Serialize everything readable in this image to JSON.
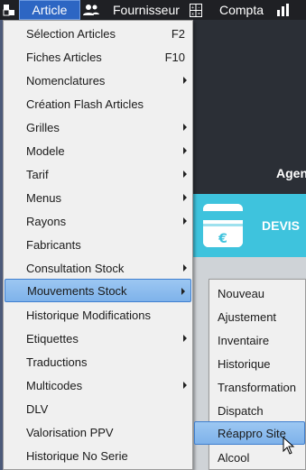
{
  "menubar": {
    "logo_icon": "app-logo-icon",
    "article_label": "Article",
    "users_icon": "users-icon",
    "fournisseur_label": "Fournisseur",
    "calculator_icon": "calculator-icon",
    "compta_label": "Compta",
    "chart_icon": "bar-chart-icon"
  },
  "background": {
    "agenda_fragment": "Agen",
    "devis_label": "DEVIS",
    "devis_icon": "euro-card-icon",
    "accent_color": "#3ec3dd"
  },
  "article_menu": {
    "items": [
      {
        "label": "Sélection Articles",
        "shortcut": "F2",
        "submenu": false
      },
      {
        "label": "Fiches Articles",
        "shortcut": "F10",
        "submenu": false
      },
      {
        "label": "Nomenclatures",
        "shortcut": "",
        "submenu": true
      },
      {
        "label": "Création Flash Articles",
        "shortcut": "",
        "submenu": false
      },
      {
        "label": "Grilles",
        "shortcut": "",
        "submenu": true
      },
      {
        "label": "Modele",
        "shortcut": "",
        "submenu": true
      },
      {
        "label": "Tarif",
        "shortcut": "",
        "submenu": true
      },
      {
        "label": "Menus",
        "shortcut": "",
        "submenu": true
      },
      {
        "label": "Rayons",
        "shortcut": "",
        "submenu": true
      },
      {
        "label": "Fabricants",
        "shortcut": "",
        "submenu": false
      },
      {
        "label": "Consultation Stock",
        "shortcut": "",
        "submenu": true
      },
      {
        "label": "Mouvements Stock",
        "shortcut": "",
        "submenu": true,
        "highlighted": true
      },
      {
        "label": "Historique Modifications",
        "shortcut": "",
        "submenu": false
      },
      {
        "label": "Etiquettes",
        "shortcut": "",
        "submenu": true
      },
      {
        "label": "Traductions",
        "shortcut": "",
        "submenu": false
      },
      {
        "label": "Multicodes",
        "shortcut": "",
        "submenu": true
      },
      {
        "label": "DLV",
        "shortcut": "",
        "submenu": false
      },
      {
        "label": "Valorisation PPV",
        "shortcut": "",
        "submenu": false
      },
      {
        "label": "Historique No Serie",
        "shortcut": "",
        "submenu": false
      }
    ]
  },
  "mouvements_submenu": {
    "items": [
      {
        "label": "Nouveau"
      },
      {
        "label": "Ajustement"
      },
      {
        "label": "Inventaire"
      },
      {
        "label": "Historique"
      },
      {
        "label": "Transformation"
      },
      {
        "label": "Dispatch"
      },
      {
        "label": "Réappro Site",
        "highlighted": true
      },
      {
        "label": "Alcool"
      }
    ]
  },
  "colors": {
    "menubar_bg": "#1f2024",
    "active_menu": "#2d66c3",
    "highlight": "#8bbcee",
    "menu_bg": "#f0f0f0"
  }
}
